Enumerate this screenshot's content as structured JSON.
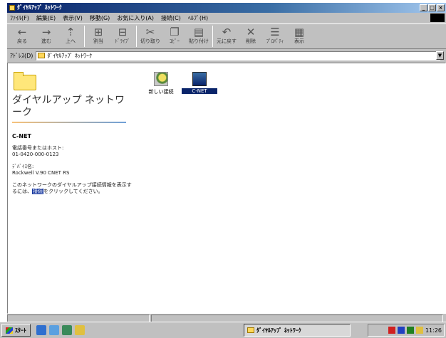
{
  "window": {
    "title": "ﾀﾞｲﾔﾙｱｯﾌﾟ ﾈｯﾄﾜｰｸ",
    "min_glyph": "_",
    "max_glyph": "□",
    "close_glyph": "×"
  },
  "menu": [
    "ﾌｧｲﾙ(F)",
    "編集(E)",
    "表示(V)",
    "移動(G)",
    "お気に入り(A)",
    "接続(C)",
    "ﾍﾙﾌﾟ(H)"
  ],
  "toolbar": [
    {
      "icon": "back-arrow-icon",
      "glyph": "←",
      "label": "戻る"
    },
    {
      "icon": "forward-arrow-icon",
      "glyph": "→",
      "label": "進む"
    },
    {
      "icon": "up-folder-icon",
      "glyph": "⇡",
      "label": "上へ"
    },
    {
      "icon": "map-drive-icon",
      "glyph": "⊞",
      "label": "割当"
    },
    {
      "icon": "disconnect-icon",
      "glyph": "⊟",
      "label": "ﾄﾞﾗｲﾌﾞ"
    },
    {
      "icon": "cut-icon",
      "glyph": "✂",
      "label": "切り取り"
    },
    {
      "icon": "copy-icon",
      "glyph": "❐",
      "label": "ｺﾋﾟｰ"
    },
    {
      "icon": "paste-icon",
      "glyph": "▤",
      "label": "貼り付け"
    },
    {
      "icon": "undo-icon",
      "glyph": "↶",
      "label": "元に戻す"
    },
    {
      "icon": "delete-icon",
      "glyph": "✕",
      "label": "削除"
    },
    {
      "icon": "properties-icon",
      "glyph": "☰",
      "label": "ﾌﾟﾛﾊﾟﾃｨ"
    },
    {
      "icon": "views-icon",
      "glyph": "▦",
      "label": "表示"
    }
  ],
  "address": {
    "label": "ｱﾄﾞﾚｽ(D)",
    "value": "ﾀﾞｲﾔﾙｱｯﾌﾟ ﾈｯﾄﾜｰｸ"
  },
  "left_pane": {
    "folder_title": "ダイヤルアップ ネットワーク",
    "connection_name": "C-NET",
    "phone_label": "電話番号またはホスト:",
    "phone_value": "01-0420-000-0123",
    "device_label": "ﾃﾞﾊﾞｲｽ名:",
    "device_value": "Rockwell V.90 CNET RS",
    "note_text": "このネットワークのダイヤルアップ接続情報を表示するには、",
    "note_link": "接続",
    "note_suffix": "をクリックしてください。"
  },
  "files": [
    {
      "name": "新しい接続",
      "icon": "new-connection-icon"
    },
    {
      "name": "C-NET",
      "icon": "dialup-connection-icon",
      "selected": true
    }
  ],
  "taskbar": {
    "start_label": "ｽﾀｰﾄ",
    "task_label": "ﾀﾞｲﾔﾙｱｯﾌﾟ ﾈｯﾄﾜｰｸ",
    "clock": "11:26"
  }
}
